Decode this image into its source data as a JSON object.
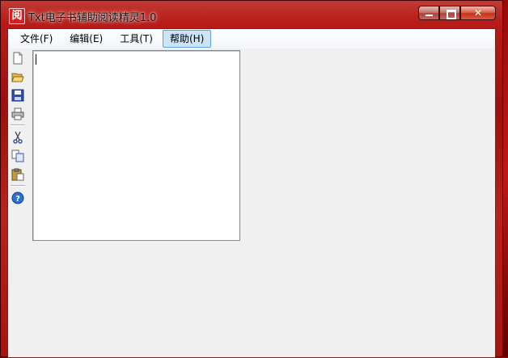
{
  "window": {
    "title": "Txt电子书辅助阅读精灵1.0",
    "icon_char": "阅"
  },
  "caption_buttons": {
    "minimize_icon": "minimize-icon",
    "maximize_icon": "maximize-icon",
    "close_label": "✕"
  },
  "menu": [
    {
      "label": "文件(F)"
    },
    {
      "label": "编辑(E)"
    },
    {
      "label": "工具(T)"
    },
    {
      "label": "帮助(H)",
      "active": true
    }
  ],
  "toolbar": [
    "new-file-icon",
    "open-folder-icon",
    "save-icon",
    "print-icon",
    "cut-icon",
    "copy-icon",
    "paste-icon",
    "help-icon"
  ],
  "editor": {
    "value": ""
  },
  "colors": {
    "titlebar": "#b81c18",
    "client_bg": "#f0f0f0",
    "menu_highlight": "#cce4f7"
  }
}
